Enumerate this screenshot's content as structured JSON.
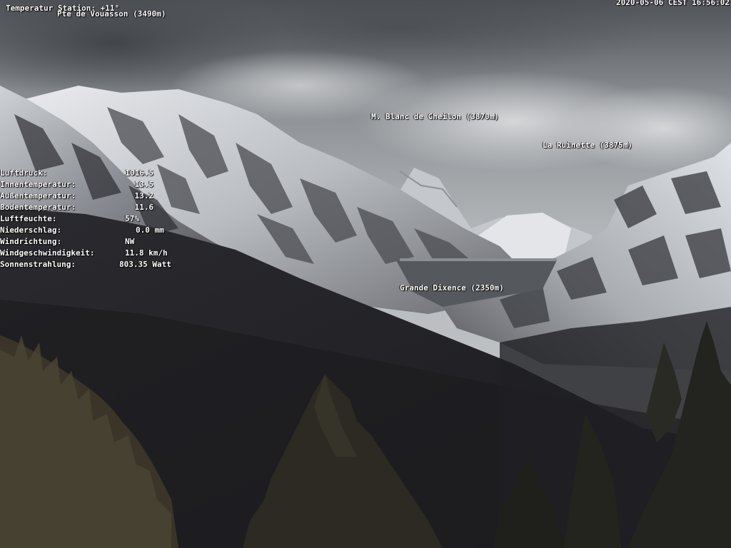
{
  "header": {
    "station_temp": "Temperatur Station: +11°",
    "peak_label": "Pte de Vouasson (3490m)",
    "timestamp": "2020-05-06 CEST 16:56:02"
  },
  "peaks": [
    {
      "label": "M. Blanc de Cheilon (3870m)"
    },
    {
      "label": "La Ruinette (3875m)"
    },
    {
      "label": "Grande Dixence (2350m)"
    }
  ],
  "weather": [
    {
      "label": "Luftdruck:",
      "value": "1016.5"
    },
    {
      "label": "Innentemperatur:",
      "value": "13.5"
    },
    {
      "label": "Außentemperatur:",
      "value": "13.2"
    },
    {
      "label": "Bodentemperatur:",
      "value": "11.6"
    },
    {
      "label": "Luftfeuchte:",
      "value": "57%"
    },
    {
      "label": "Niederschlag:",
      "value": "0.0 mm"
    },
    {
      "label": "Windrichtung:",
      "value": "NW"
    },
    {
      "label": "Windgeschwindigkeit:",
      "value": "11.8 km/h"
    },
    {
      "label": "Sonnenstrahlung:",
      "value": "803.35 Watt"
    }
  ],
  "colors": {
    "overlay_text": "#ffffff",
    "sky": "#b9bcbf",
    "snow": "#e4e6e9",
    "forest": "#1c1c20"
  }
}
